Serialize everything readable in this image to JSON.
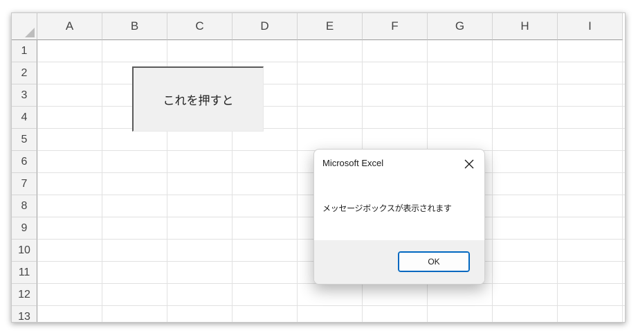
{
  "sheet": {
    "columns": [
      "A",
      "B",
      "C",
      "D",
      "E",
      "F",
      "G",
      "H",
      "I"
    ],
    "rows": [
      "1",
      "2",
      "3",
      "4",
      "5",
      "6",
      "7",
      "8",
      "9",
      "10",
      "11",
      "12",
      "13"
    ]
  },
  "macro_button": {
    "label": "これを押すと"
  },
  "dialog": {
    "title": "Microsoft Excel",
    "message": "メッセージボックスが表示されます",
    "ok_label": "OK",
    "close_icon": "close-icon"
  },
  "colors": {
    "header_bg": "#f3f3f3",
    "gridline": "#e1e1e1",
    "ok_border": "#0067c0",
    "dialog_footer": "#f0f0f0"
  }
}
